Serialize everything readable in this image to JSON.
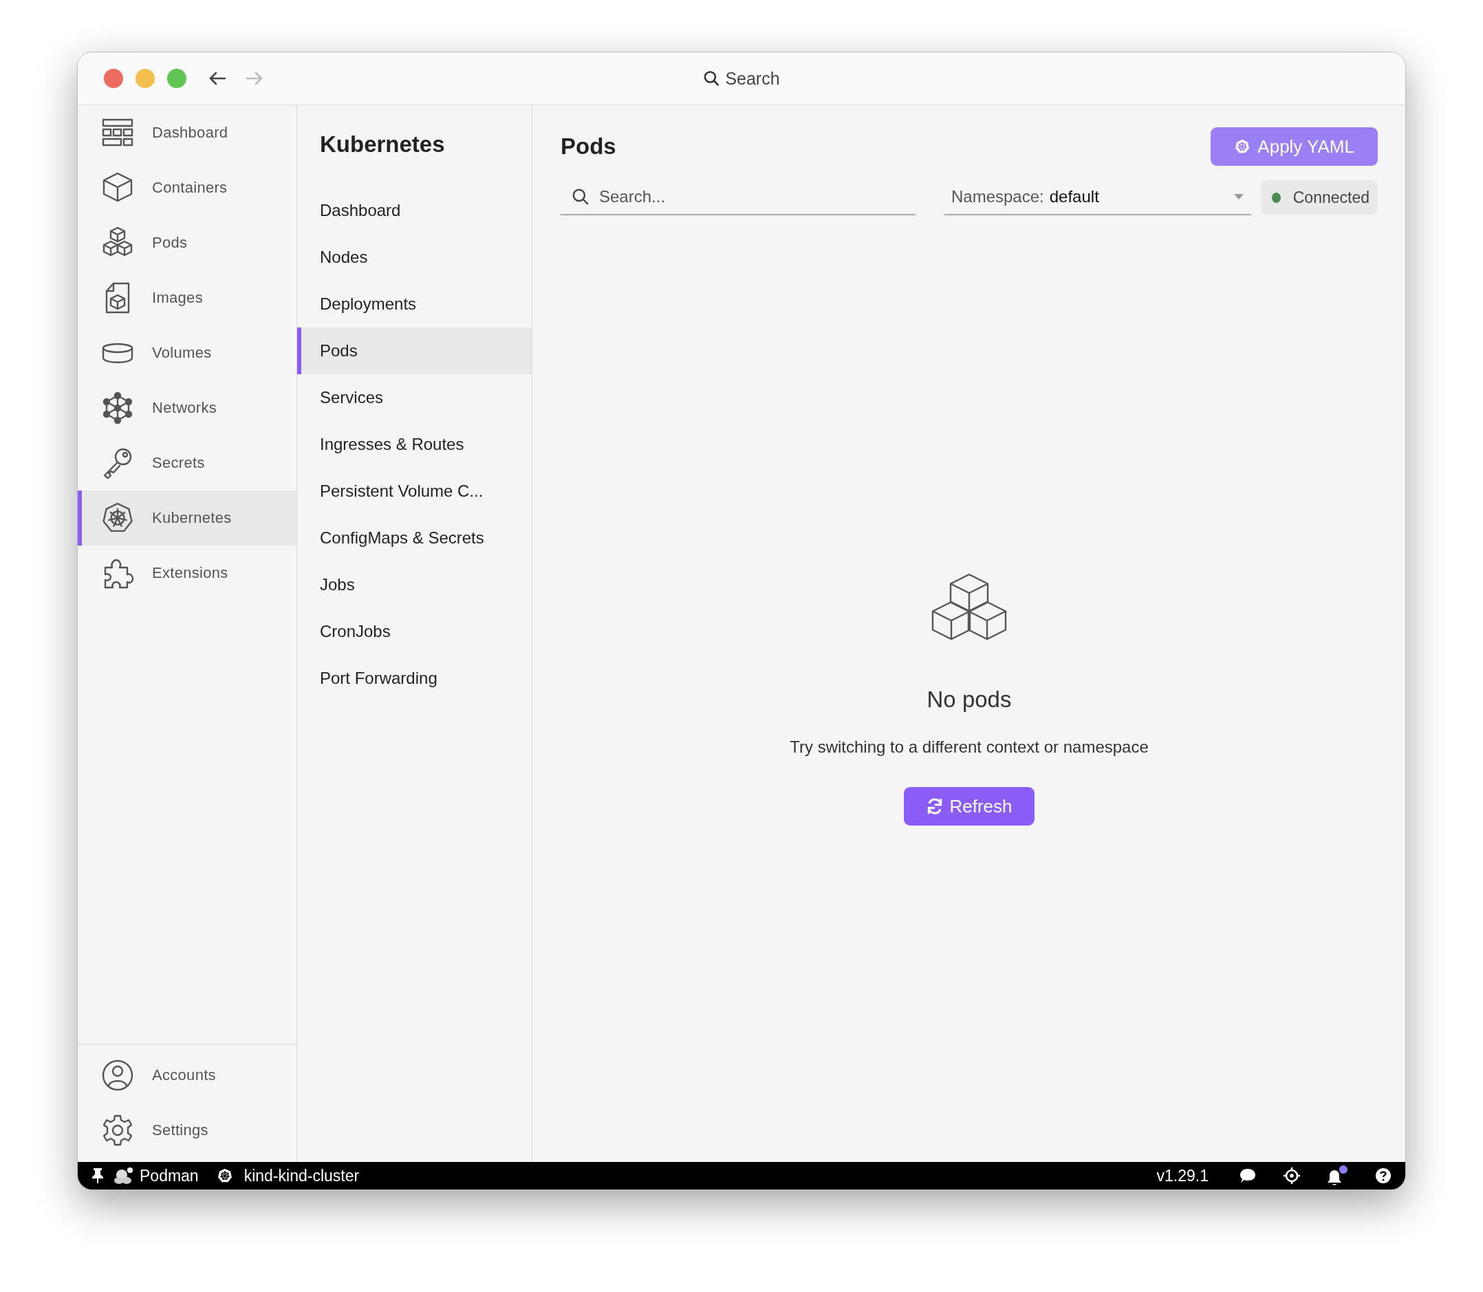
{
  "window": {
    "search_label": "Search",
    "nav": [
      {
        "kind": "back",
        "disabled": false
      },
      {
        "kind": "forward",
        "disabled": true
      }
    ]
  },
  "sidebar": {
    "items": [
      {
        "label": "Dashboard",
        "kind": "dashboard",
        "selected": false
      },
      {
        "label": "Containers",
        "kind": "container",
        "selected": false
      },
      {
        "label": "Pods",
        "kind": "pods",
        "selected": false
      },
      {
        "label": "Images",
        "kind": "image",
        "selected": false
      },
      {
        "label": "Volumes",
        "kind": "volume",
        "selected": false
      },
      {
        "label": "Networks",
        "kind": "network",
        "selected": false
      },
      {
        "label": "Secrets",
        "kind": "key",
        "selected": false
      },
      {
        "label": "Kubernetes",
        "kind": "kube",
        "selected": true
      },
      {
        "label": "Extensions",
        "kind": "puzzle",
        "selected": false
      }
    ],
    "bottom_items": [
      {
        "label": "Accounts",
        "kind": "account"
      },
      {
        "label": "Settings",
        "kind": "gear"
      }
    ]
  },
  "subnav": {
    "title": "Kubernetes",
    "items": [
      {
        "label": "Dashboard",
        "selected": false
      },
      {
        "label": "Nodes",
        "selected": false
      },
      {
        "label": "Deployments",
        "selected": false
      },
      {
        "label": "Pods",
        "selected": true
      },
      {
        "label": "Services",
        "selected": false
      },
      {
        "label": "Ingresses & Routes",
        "selected": false
      },
      {
        "label": "Persistent Volume C...",
        "selected": false
      },
      {
        "label": "ConfigMaps & Secrets",
        "selected": false
      },
      {
        "label": "Jobs",
        "selected": false
      },
      {
        "label": "CronJobs",
        "selected": false
      },
      {
        "label": "Port Forwarding",
        "selected": false
      }
    ]
  },
  "main": {
    "title": "Pods",
    "apply_button": "Apply YAML",
    "search": {
      "placeholder": "Search..."
    },
    "namespace": {
      "label": "Namespace:",
      "value": "default"
    },
    "status": {
      "label": "Connected",
      "connected": true
    },
    "empty": {
      "title": "No pods",
      "message": "Try switching to a different context or namespace",
      "button": "Refresh"
    }
  },
  "status_bar": {
    "engine": "Podman",
    "context": "kind-kind-cluster",
    "version": "v1.29.1",
    "unread_notifications": true
  }
}
